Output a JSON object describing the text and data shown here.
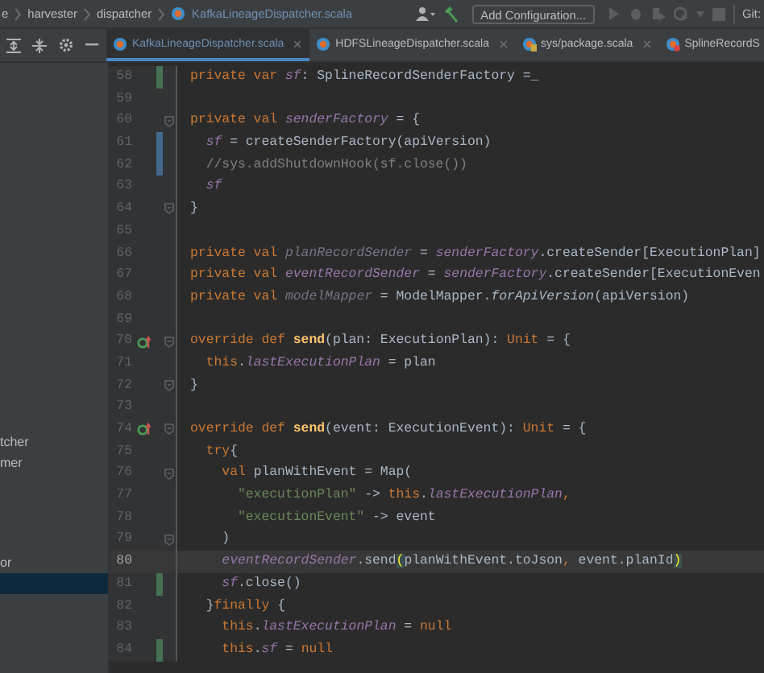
{
  "breadcrumbs": [
    {
      "label": "e",
      "kind": "folder"
    },
    {
      "label": "harvester",
      "kind": "folder"
    },
    {
      "label": "dispatcher",
      "kind": "folder"
    },
    {
      "label": "KafkaLineageDispatcher.scala",
      "kind": "file"
    }
  ],
  "toolbar": {
    "run_configuration": "Add Configuration...",
    "vcs_label": "Git:"
  },
  "tabs": [
    {
      "label": "KafkaLineageDispatcher.scala",
      "selected": true
    },
    {
      "label": "HDFSLineageDispatcher.scala",
      "selected": false
    },
    {
      "label": "sys/package.scala",
      "selected": false
    },
    {
      "label": "SplineRecordS",
      "selected": false
    }
  ],
  "sidebar": {
    "items": [
      {
        "label": "tcher",
        "selected": false
      },
      {
        "label": "mer",
        "selected": false
      },
      {
        "label": "or",
        "selected": false
      },
      {
        "selected": true
      }
    ]
  },
  "editor": {
    "lines": [
      {
        "number": "58",
        "change_marker": {
          "color": "#447152"
        },
        "tokens": [
          {
            "text": "private var ",
            "kind": "kw"
          },
          {
            "text": "sf",
            "kind": "field"
          },
          {
            "text": ": SplineRecordSenderFactory =_",
            "kind": "plain"
          }
        ]
      },
      {
        "number": "59"
      },
      {
        "number": "60",
        "fold": true,
        "tokens": [
          {
            "text": "private val ",
            "kind": "kw"
          },
          {
            "text": "senderFactory",
            "kind": "field"
          },
          {
            "text": " = {",
            "kind": "plain"
          }
        ]
      },
      {
        "number": "61",
        "change_marker": {
          "color": "#43698d"
        },
        "tokens": [
          {
            "text": "  sf",
            "kind": "field"
          },
          {
            "text": " = createSenderFactory(apiVersion)",
            "kind": "plain"
          }
        ]
      },
      {
        "number": "62",
        "change_marker": {
          "color": "#43698d"
        },
        "tokens": [
          {
            "text": "  //sys.addShutdownHook(sf.close())",
            "kind": "comment"
          }
        ]
      },
      {
        "number": "63",
        "tokens": [
          {
            "text": "  sf",
            "kind": "field"
          }
        ]
      },
      {
        "number": "64",
        "fold": true,
        "tokens": [
          {
            "text": "}",
            "kind": "plain"
          }
        ]
      },
      {
        "number": "65"
      },
      {
        "number": "66",
        "tokens": [
          {
            "text": "private val ",
            "kind": "kw"
          },
          {
            "text": "planRecordSender",
            "kind": "unused"
          },
          {
            "text": " = ",
            "kind": "plain"
          },
          {
            "text": "senderFactory",
            "kind": "field"
          },
          {
            "text": ".createSender[ExecutionPlan]",
            "kind": "plain"
          }
        ]
      },
      {
        "number": "67",
        "tokens": [
          {
            "text": "private val ",
            "kind": "kw"
          },
          {
            "text": "eventRecordSender",
            "kind": "field"
          },
          {
            "text": " = ",
            "kind": "plain"
          },
          {
            "text": "senderFactory",
            "kind": "field"
          },
          {
            "text": ".createSender[ExecutionEven",
            "kind": "plain"
          }
        ]
      },
      {
        "number": "68",
        "tokens": [
          {
            "text": "private val ",
            "kind": "kw"
          },
          {
            "text": "modelMapper",
            "kind": "unused"
          },
          {
            "text": " = ModelMapper.",
            "kind": "plain"
          },
          {
            "text": "forApiVersion",
            "kind": "italic"
          },
          {
            "text": "(apiVersion)",
            "kind": "plain"
          }
        ]
      },
      {
        "number": "69"
      },
      {
        "number": "70",
        "override": true,
        "fold": true,
        "tokens": [
          {
            "text": "override def ",
            "kind": "kw"
          },
          {
            "text": "send",
            "kind": "fn"
          },
          {
            "text": "(plan: ExecutionPlan): ",
            "kind": "plain"
          },
          {
            "text": "Unit",
            "kind": "kw"
          },
          {
            "text": " = {",
            "kind": "plain"
          }
        ]
      },
      {
        "number": "71",
        "tokens": [
          {
            "text": "  this",
            "kind": "kw"
          },
          {
            "text": ".",
            "kind": "plain"
          },
          {
            "text": "lastExecutionPlan",
            "kind": "field"
          },
          {
            "text": " = plan",
            "kind": "plain"
          }
        ]
      },
      {
        "number": "72",
        "fold": true,
        "tokens": [
          {
            "text": "}",
            "kind": "plain"
          }
        ]
      },
      {
        "number": "73"
      },
      {
        "number": "74",
        "override": true,
        "fold": true,
        "tokens": [
          {
            "text": "override def ",
            "kind": "kw"
          },
          {
            "text": "send",
            "kind": "fn"
          },
          {
            "text": "(event: ExecutionEvent): ",
            "kind": "plain"
          },
          {
            "text": "Unit",
            "kind": "kw"
          },
          {
            "text": " = {",
            "kind": "plain"
          }
        ]
      },
      {
        "number": "75",
        "tokens": [
          {
            "text": "  try",
            "kind": "kw"
          },
          {
            "text": "{",
            "kind": "plain"
          }
        ]
      },
      {
        "number": "76",
        "fold": true,
        "tokens": [
          {
            "text": "    val",
            "kind": "kw"
          },
          {
            "text": " planWithEvent = Map(",
            "kind": "plain"
          }
        ]
      },
      {
        "number": "77",
        "tokens": [
          {
            "text": "      \"executionPlan\"",
            "kind": "str"
          },
          {
            "text": " -> ",
            "kind": "plain"
          },
          {
            "text": "this",
            "kind": "kw"
          },
          {
            "text": ".",
            "kind": "plain"
          },
          {
            "text": "lastExecutionPlan",
            "kind": "field"
          },
          {
            "text": ",",
            "kind": "kw"
          }
        ]
      },
      {
        "number": "78",
        "tokens": [
          {
            "text": "      \"executionEvent\"",
            "kind": "str"
          },
          {
            "text": " -> event",
            "kind": "plain"
          }
        ]
      },
      {
        "number": "79",
        "fold": true,
        "tokens": [
          {
            "text": "    )",
            "kind": "plain"
          }
        ]
      },
      {
        "number": "80",
        "current": true,
        "tokens": [
          {
            "text": "    eventRecordSender",
            "kind": "field"
          },
          {
            "text": ".send",
            "kind": "plain"
          },
          {
            "text": "(",
            "kind": "brace"
          },
          {
            "text": "planWithEvent.toJson",
            "kind": "plain"
          },
          {
            "text": ", ",
            "kind": "kw"
          },
          {
            "text": "event.planId",
            "kind": "plain"
          },
          {
            "text": ")",
            "kind": "brace"
          }
        ]
      },
      {
        "number": "81",
        "change_marker": {
          "color": "#447152"
        },
        "tokens": [
          {
            "text": "    sf",
            "kind": "field"
          },
          {
            "text": ".close()",
            "kind": "plain"
          }
        ]
      },
      {
        "number": "82",
        "tokens": [
          {
            "text": "  }",
            "kind": "plain"
          },
          {
            "text": "finally",
            "kind": "kw"
          },
          {
            "text": " {",
            "kind": "plain"
          }
        ]
      },
      {
        "number": "83",
        "tokens": [
          {
            "text": "    this",
            "kind": "kw"
          },
          {
            "text": ".",
            "kind": "plain"
          },
          {
            "text": "lastExecutionPlan",
            "kind": "field"
          },
          {
            "text": " = ",
            "kind": "plain"
          },
          {
            "text": "null",
            "kind": "kw"
          }
        ]
      },
      {
        "number": "84",
        "change_marker": {
          "color": "#447152"
        },
        "tokens": [
          {
            "text": "    this",
            "kind": "kw"
          },
          {
            "text": ".",
            "kind": "plain"
          },
          {
            "text": "sf",
            "kind": "field"
          },
          {
            "text": " = ",
            "kind": "plain"
          },
          {
            "text": "null",
            "kind": "kw"
          }
        ]
      }
    ]
  }
}
